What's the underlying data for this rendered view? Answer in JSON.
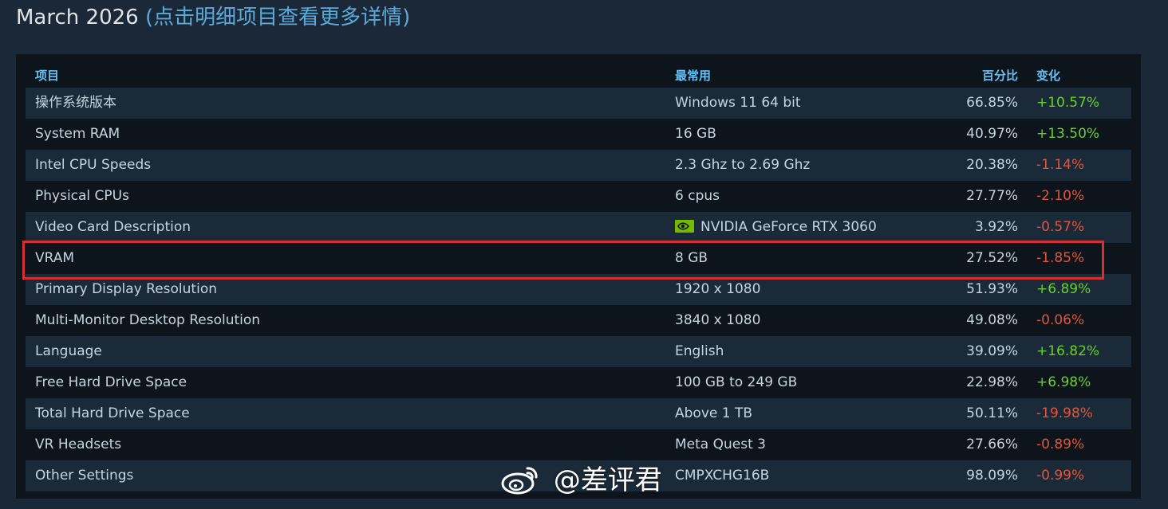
{
  "page": {
    "title_main": "March 2026",
    "title_sub": "(点击明细项目查看更多详情)"
  },
  "table": {
    "headers": {
      "name": "项目",
      "common": "最常用",
      "percent": "百分比",
      "change": "变化"
    },
    "rows": [
      {
        "name": "操作系统版本",
        "common": "Windows 11 64 bit",
        "percent": "66.85%",
        "change": "+10.57%",
        "trend": "up"
      },
      {
        "name": "System RAM",
        "common": "16 GB",
        "percent": "40.97%",
        "change": "+13.50%",
        "trend": "up"
      },
      {
        "name": "Intel CPU Speeds",
        "common": "2.3 Ghz to 2.69 Ghz",
        "percent": "20.38%",
        "change": "-1.14%",
        "trend": "down"
      },
      {
        "name": "Physical CPUs",
        "common": "6 cpus",
        "percent": "27.77%",
        "change": "-2.10%",
        "trend": "down"
      },
      {
        "name": "Video Card Description",
        "common": "NVIDIA GeForce RTX 3060",
        "percent": "3.92%",
        "change": "-0.57%",
        "trend": "down",
        "icon": "nvidia-logo-icon"
      },
      {
        "name": "VRAM",
        "common": "8 GB",
        "percent": "27.52%",
        "change": "-1.85%",
        "trend": "down",
        "highlighted": true
      },
      {
        "name": "Primary Display Resolution",
        "common": "1920 x 1080",
        "percent": "51.93%",
        "change": "+6.89%",
        "trend": "up"
      },
      {
        "name": "Multi-Monitor Desktop Resolution",
        "common": "3840 x 1080",
        "percent": "49.08%",
        "change": "-0.06%",
        "trend": "down"
      },
      {
        "name": "Language",
        "common": "English",
        "percent": "39.09%",
        "change": "+16.82%",
        "trend": "up"
      },
      {
        "name": "Free Hard Drive Space",
        "common": "100 GB to 249 GB",
        "percent": "22.98%",
        "change": "+6.98%",
        "trend": "up"
      },
      {
        "name": "Total Hard Drive Space",
        "common": "Above 1 TB",
        "percent": "50.11%",
        "change": "-19.98%",
        "trend": "down"
      },
      {
        "name": "VR Headsets",
        "common": "Meta Quest 3",
        "percent": "27.66%",
        "change": "-0.89%",
        "trend": "down"
      },
      {
        "name": "Other Settings",
        "common": "CMPXCHG16B",
        "percent": "98.09%",
        "change": "-0.99%",
        "trend": "down"
      }
    ]
  },
  "watermark": {
    "text": "@差评君",
    "icon": "weibo-icon"
  },
  "colors": {
    "background": "#1b2838",
    "header_text": "#66c0f4",
    "positive": "#6bcf2d",
    "negative": "#e2553a",
    "highlight_border": "#d62f2f"
  }
}
